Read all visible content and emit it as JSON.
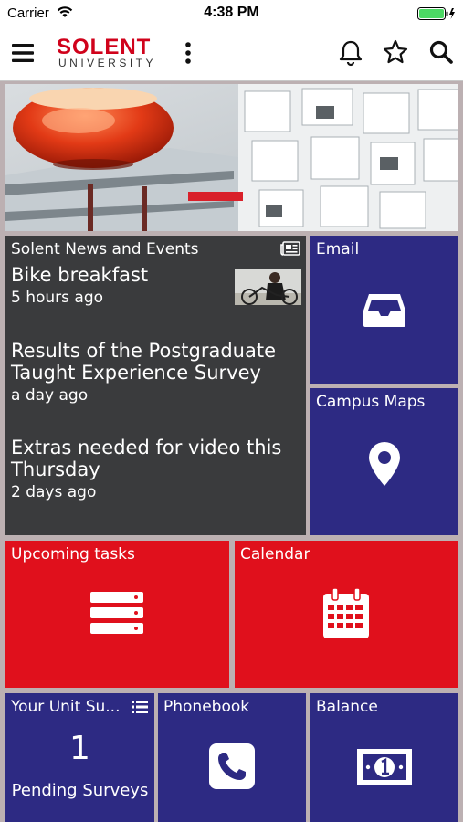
{
  "status_bar": {
    "carrier": "Carrier",
    "time": "4:38 PM"
  },
  "nav": {
    "logo_line1": "SOLENT",
    "logo_line2": "UNIVERSITY"
  },
  "tiles": {
    "news": {
      "title": "Solent News and Events",
      "items": [
        {
          "headline": "Bike breakfast",
          "time": "5 hours ago"
        },
        {
          "headline": "Results of the Postgraduate Taught Experience Survey",
          "time": "a day ago"
        },
        {
          "headline": "Extras needed for video this Thursday",
          "time": "2 days ago"
        }
      ]
    },
    "email": {
      "label": "Email",
      "icon": "inbox-icon"
    },
    "campus_maps": {
      "label": "Campus Maps",
      "icon": "map-pin-icon"
    },
    "upcoming_tasks": {
      "label": "Upcoming tasks",
      "icon": "tasks-list-icon"
    },
    "calendar": {
      "label": "Calendar",
      "icon": "calendar-icon"
    },
    "unit_surveys": {
      "label": "Your Unit Su...",
      "count": "1",
      "subtitle": "Pending Surveys",
      "icon": "list-icon"
    },
    "phonebook": {
      "label": "Phonebook",
      "icon": "phone-icon"
    },
    "balance": {
      "label": "Balance",
      "icon": "banknote-icon"
    }
  },
  "colors": {
    "brand_red": "#e0101c",
    "tile_blue": "#2d2a83",
    "tile_dark": "#3a3b3d",
    "background": "#bcb0b2"
  }
}
